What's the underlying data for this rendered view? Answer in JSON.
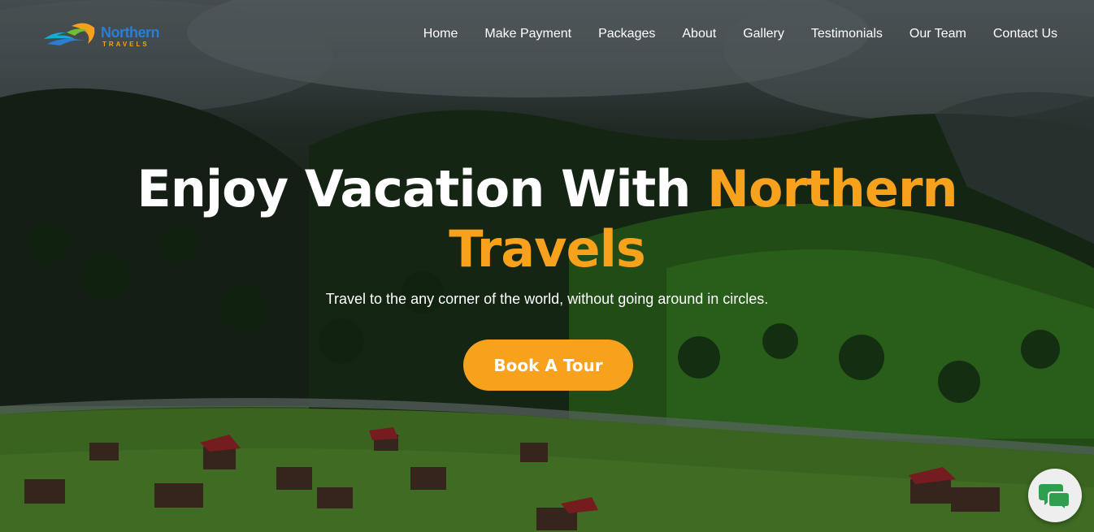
{
  "brand": {
    "logo_word": "Northern",
    "logo_sub": "TRAVELS",
    "logo_icon": "wave-swoosh-logo-icon",
    "colors": {
      "blue": "#2a7fd4",
      "orange": "#f7a01a",
      "cyan": "#1aa9d6"
    }
  },
  "nav": {
    "items": [
      {
        "label": "Home"
      },
      {
        "label": "Make Payment"
      },
      {
        "label": "Packages"
      },
      {
        "label": "About"
      },
      {
        "label": "Gallery"
      },
      {
        "label": "Testimonials"
      },
      {
        "label": "Our Team"
      },
      {
        "label": "Contact Us"
      }
    ]
  },
  "hero": {
    "headline_white": "Enjoy Vacation With ",
    "headline_accent_1": "Northern",
    "headline_accent_2": "Travels",
    "subline": "Travel to the any corner of the world, without going around in circles.",
    "cta_label": "Book A Tour",
    "accent_color": "#f7a11c"
  },
  "chat_widget": {
    "icon": "chat-bubbles-icon",
    "color": "#2e9e4f"
  }
}
